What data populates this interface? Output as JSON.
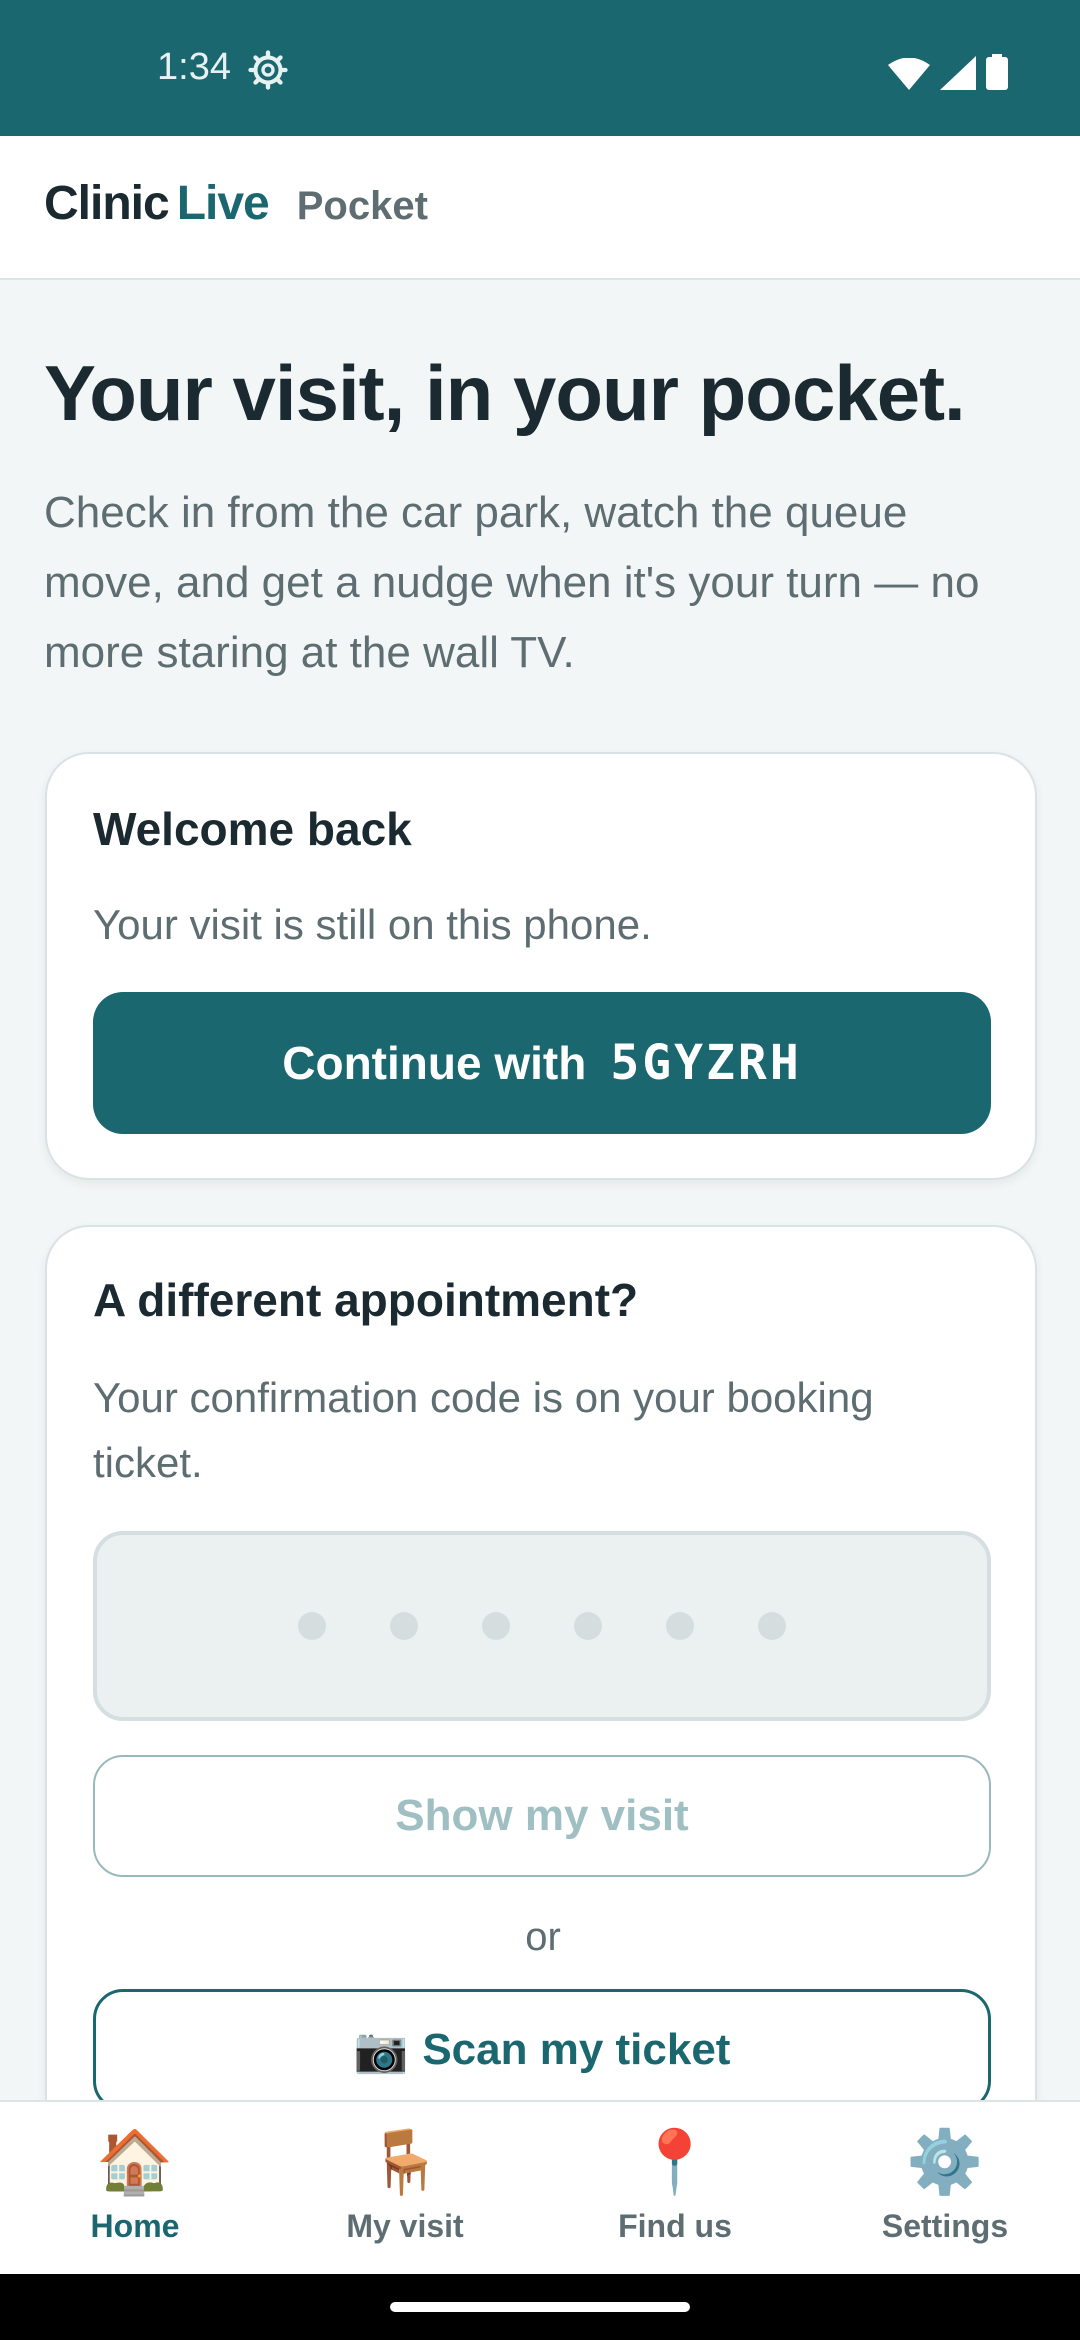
{
  "status_bar": {
    "time": "1:34",
    "icons": [
      "gear-icon",
      "wifi-icon",
      "signal-icon",
      "battery-icon"
    ]
  },
  "header": {
    "brand_clinic": "Clinic",
    "brand_live": "Live",
    "brand_sub": "Pocket"
  },
  "hero": {
    "title": "Your visit, in your pocket.",
    "text": "Check in from the car park, watch the queue move, and get a nudge when it's your turn — no more staring at the wall TV."
  },
  "welcome_card": {
    "title": "Welcome back",
    "text": "Your visit is still on this phone.",
    "button_label": "Continue with",
    "button_code": "5GYZRH"
  },
  "different_card": {
    "title": "A different appointment?",
    "text": "Your confirmation code is on your booking ticket.",
    "code_placeholder_dots": 6,
    "show_button": "Show my visit",
    "or_text": "or",
    "scan_emoji": "📷",
    "scan_button": "Scan my ticket"
  },
  "bottom_nav": {
    "items": [
      {
        "label": "Home",
        "icon": "🏠",
        "active": true
      },
      {
        "label": "My visit",
        "icon": "🪑",
        "active": false
      },
      {
        "label": "Find us",
        "icon": "📍",
        "active": false
      },
      {
        "label": "Settings",
        "icon": "⚙️",
        "active": false
      }
    ]
  },
  "colors": {
    "brand": "#1a6770",
    "text_dark": "#1b2a30",
    "text_muted": "#5d6d72",
    "background": "#f3f6f6"
  }
}
